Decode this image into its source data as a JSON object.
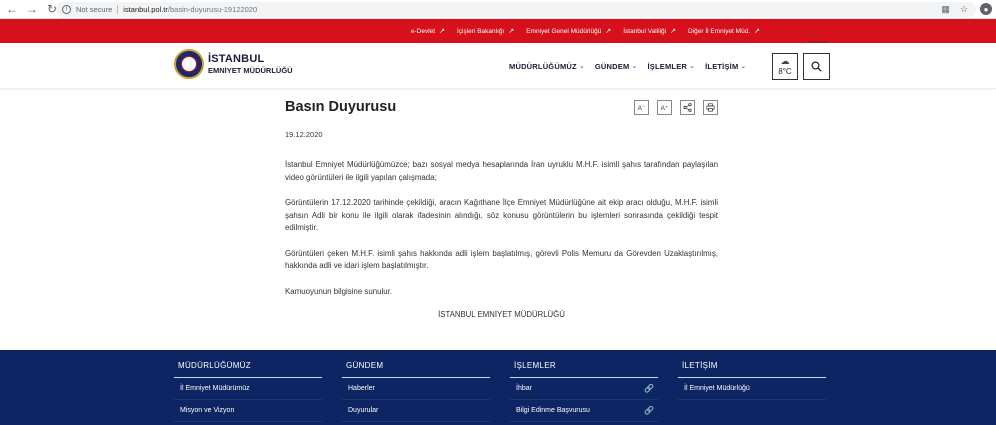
{
  "browser": {
    "security": "Not secure",
    "url_host": "istanbul.pol.tr",
    "url_path": "/basin-duyurusu-19122020"
  },
  "topbar": {
    "links": [
      {
        "label": "e-Devlet"
      },
      {
        "label": "İçişleri Bakanlığı"
      },
      {
        "label": "Emniyet Genel Müdürlüğü"
      },
      {
        "label": "İstanbul Valiliği"
      },
      {
        "label": "Diğer İl Emniyet Müd."
      }
    ]
  },
  "header": {
    "logo_line1": "İSTANBUL",
    "logo_line2": "EMNİYET MÜDÜRLÜĞÜ",
    "nav": [
      {
        "label": "MÜDÜRLÜĞÜMÜZ"
      },
      {
        "label": "GÜNDEM"
      },
      {
        "label": "İŞLEMLER"
      },
      {
        "label": "İLETİŞİM"
      }
    ],
    "weather_temp": "8°C"
  },
  "article": {
    "title": "Basın Duyurusu",
    "date": "19.12.2020",
    "tools": {
      "decrease": "A⁻",
      "increase": "A⁺"
    },
    "paragraphs": [
      "İstanbul Emniyet Müdürlüğümüzce; bazı sosyal medya hesaplarında İran uyruklu M.H.F. isimli şahıs tarafından paylaşılan video görüntüleri ile ilgili yapılan çalışmada;",
      "Görüntülerin 17.12.2020 tarihinde çekildiği, aracın Kağıthane İlçe Emniyet Müdürlüğüne ait ekip aracı olduğu, M.H.F. isimli şahsın Adli bir konu ile ilgili olarak ifadesinin alındığı, söz konusu görüntülerin bu işlemleri sonrasında çekildiği tespit edilmiştir.",
      "Görüntüleri çeken M.H.F. isimli şahıs hakkında adli işlem başlatılmış, görevli Polis Memuru da Görevden Uzaklaştırılmış, hakkında adli ve idari işlem başlatılmıştır.",
      "Kamuoyunun bilgisine sunulur."
    ],
    "signature": "İSTANBUL EMNİYET MÜDÜRLÜĞÜ"
  },
  "footer": {
    "columns": [
      {
        "heading": "MÜDÜRLÜĞÜMÜZ",
        "links": [
          "İl Emniyet Müdürümüz",
          "Misyon ve Vizyon"
        ]
      },
      {
        "heading": "GÜNDEM",
        "links": [
          "Haberler",
          "Duyurular"
        ]
      },
      {
        "heading": "İŞLEMLER",
        "links": [
          "İhbar",
          "Bilgi Edinme Başvurusu"
        ]
      },
      {
        "heading": "İLETİŞİM",
        "links": [
          "İl Emniyet Müdürlüğü"
        ]
      }
    ]
  },
  "colors": {
    "topbar": "#d6111b",
    "footer": "#0d2562"
  }
}
